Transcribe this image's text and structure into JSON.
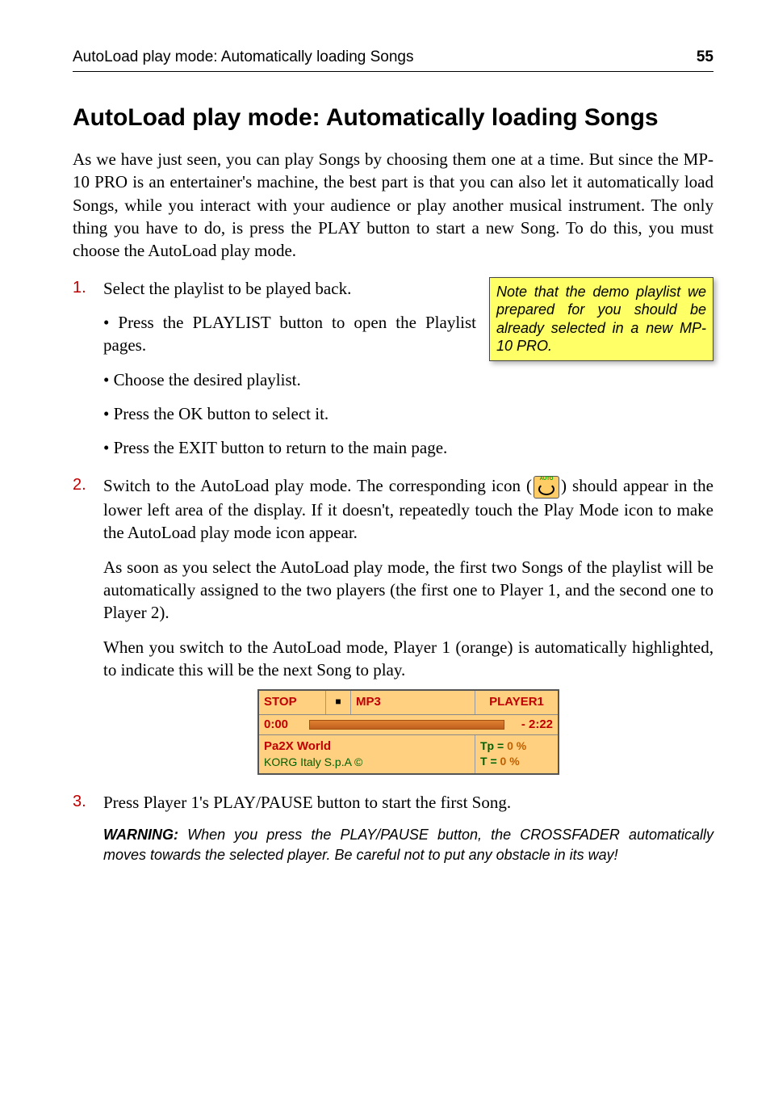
{
  "header": {
    "title": "AutoLoad play mode: Automatically loading Songs",
    "page_number": "55"
  },
  "heading": "AutoLoad play mode: Automatically loading Songs",
  "intro": "As we have just seen, you can play Songs by choosing them one at a time. But since the MP-10 PRO is an entertainer's machine, the best part is that you can also let it automatically load Songs, while you interact with your audience or play another musical instrument. The only thing you have to do, is press the PLAY button to start a new Song. To do this, you must choose the AutoLoad play mode.",
  "note": "Note that the demo playlist we prepared for you should be already selected in a new MP-10 PRO.",
  "steps": {
    "s1": {
      "text": "Select the playlist to be played back.",
      "b1": "• Press the PLAYLIST button to open the Playlist pages.",
      "b2": "• Choose the desired playlist.",
      "b3": "• Press the OK button to select it.",
      "b4": "• Press the EXIT button to return to the main page."
    },
    "s2": {
      "text_a": "Switch to the AutoLoad play mode. The corresponding icon (",
      "text_b": ") should appear in the lower left area of the display. If it doesn't, repeatedly touch the Play Mode icon to make the AutoLoad play mode icon appear.",
      "para2": "As soon as you select the AutoLoad play mode, the first two Songs of the playlist will be automatically assigned to the two players (the first one to Player 1, and the second one to Player 2).",
      "para3": "When you switch to the AutoLoad mode, Player 1 (orange) is automatically highlighted, to indicate this will be the next Song to play."
    },
    "s3": {
      "text": "Press Player 1's PLAY/PAUSE button to start the first Song.",
      "warning_label": "WARNING:",
      "warning_text": " When you press the PLAY/PAUSE button, the CROSSFADER automatically moves towards the selected player. Be careful not to put any obstacle in its way!"
    }
  },
  "player": {
    "status": "STOP",
    "stop_glyph": "■",
    "format": "MP3",
    "label": "PLAYER1",
    "time_elapsed": "0:00",
    "time_remaining": "- 2:22",
    "song": "Pa2X World",
    "artist": "KORG Italy S.p.A ©",
    "tp_label": "Tp =",
    "tp_value": "0 %",
    "t_label": "T  =",
    "t_value": "0 %"
  },
  "icon": {
    "auto_label": "AUTO"
  }
}
